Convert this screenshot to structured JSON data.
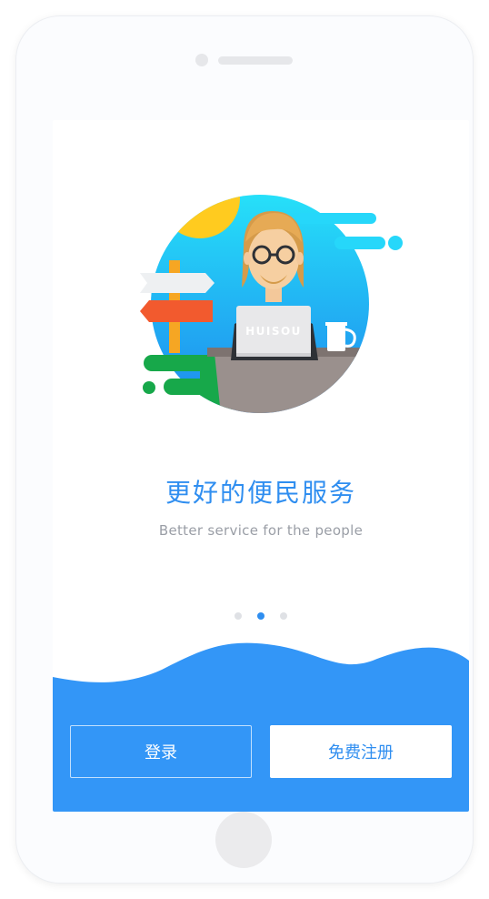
{
  "onboarding": {
    "headline": "更好的便民服务",
    "subline": "Better service for the people",
    "illustration_text": "HUISOU",
    "pager": {
      "count": 3,
      "active_index": 1
    }
  },
  "actions": {
    "login_label": "登录",
    "register_label": "免费注册"
  },
  "colors": {
    "brand_blue": "#3396f7",
    "accent_blue_text": "#2f8ef0",
    "sky_top": "#26e0f9",
    "sky_bottom": "#1e90f0",
    "sun_yellow": "#ffcb1f",
    "grass_green": "#17a84a",
    "sign_red": "#f25a2e",
    "desk_gray": "#9a908d"
  },
  "icons": [
    "camera-icon",
    "speaker-icon",
    "home-button-icon"
  ]
}
